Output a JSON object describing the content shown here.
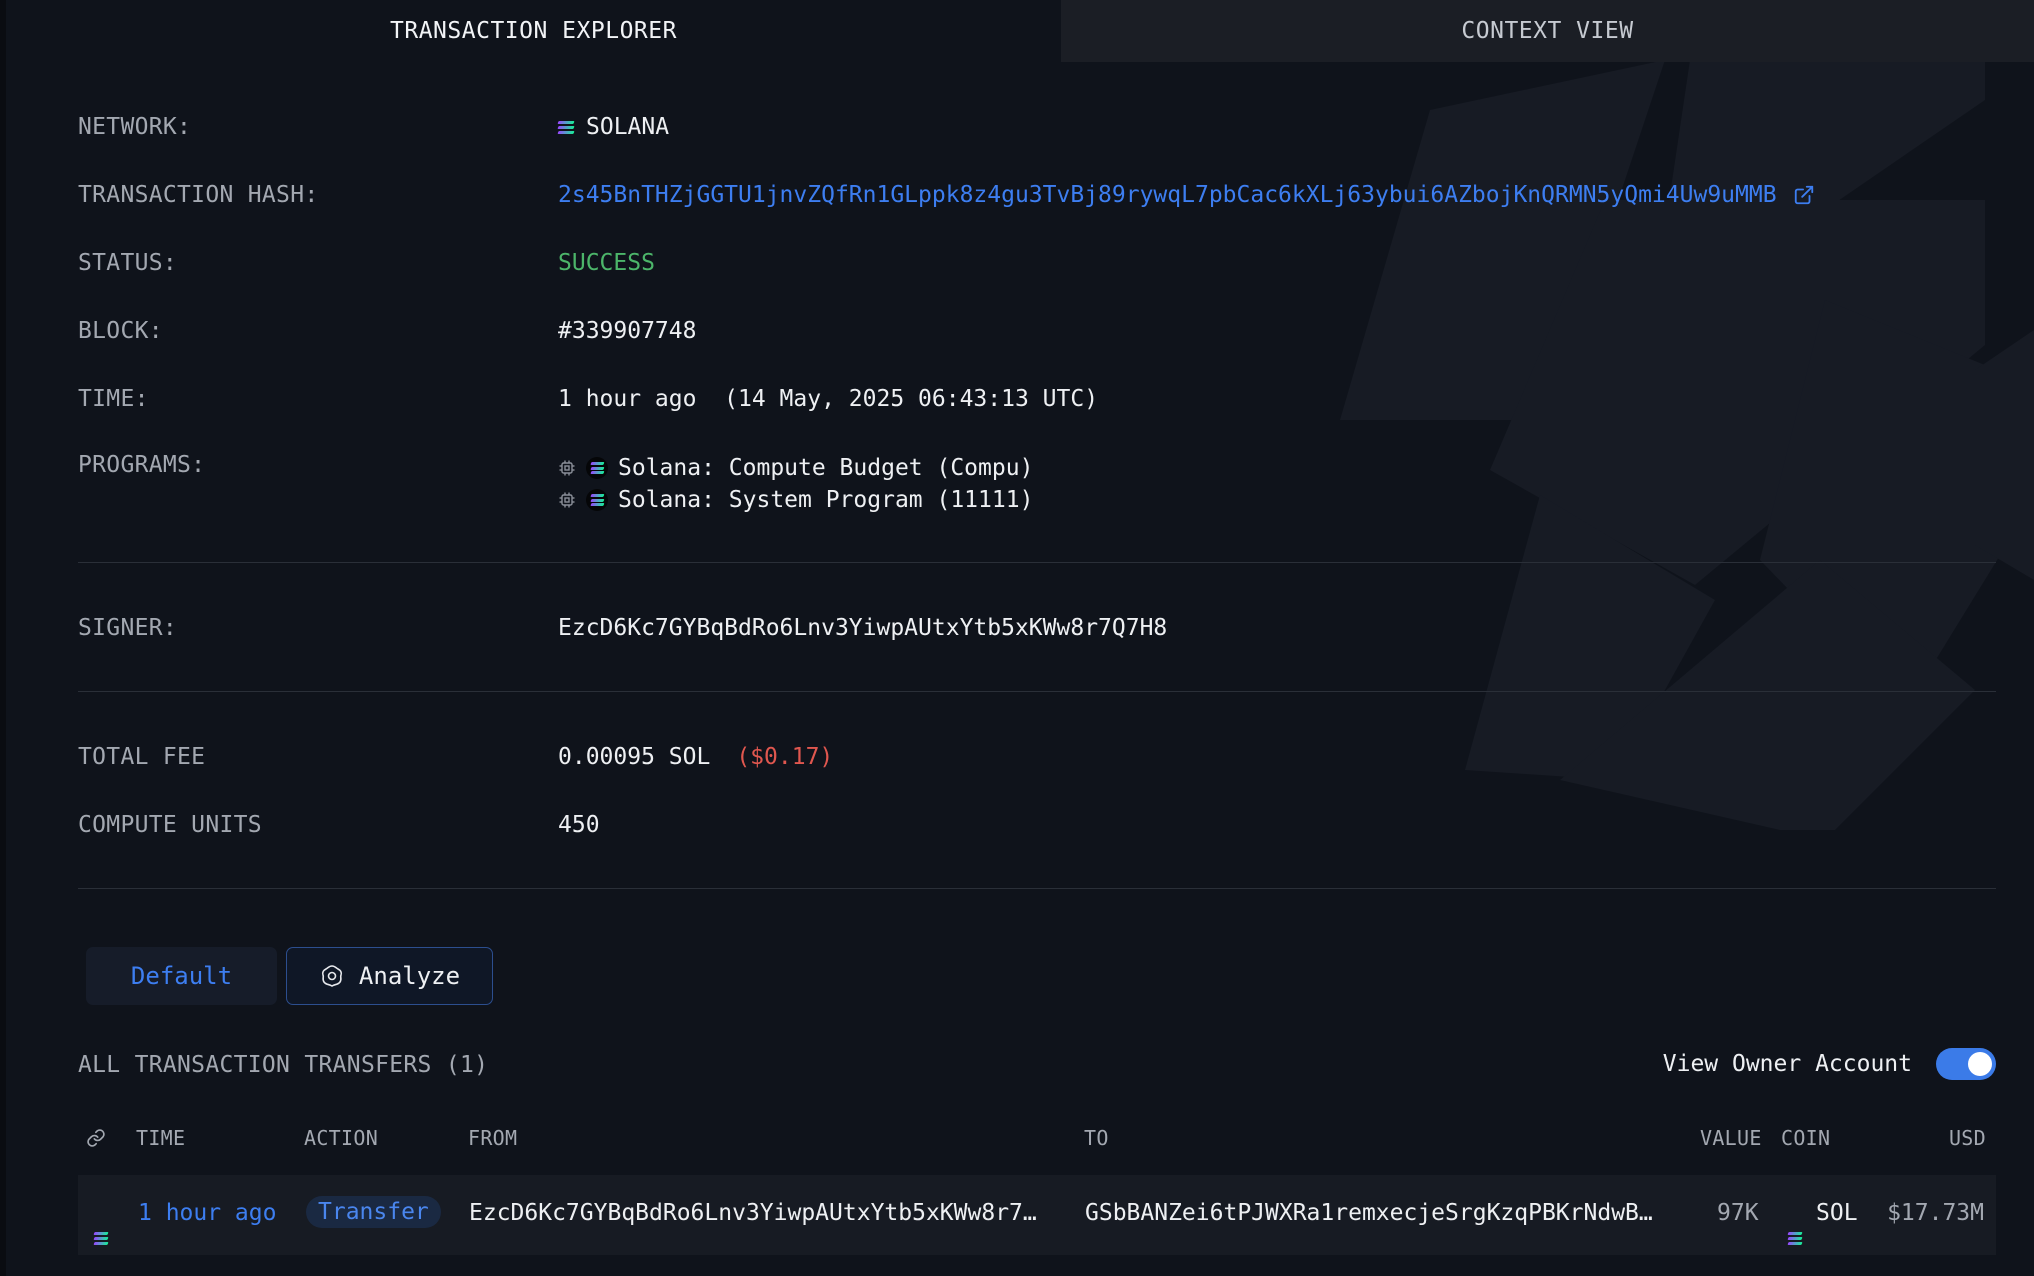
{
  "tabs": {
    "explorer": "TRANSACTION EXPLORER",
    "context": "CONTEXT VIEW"
  },
  "details": {
    "network": {
      "label": "NETWORK:",
      "value": "SOLANA"
    },
    "hash": {
      "label": "TRANSACTION HASH:",
      "value": "2s45BnTHZjGGTU1jnvZQfRn1GLppk8z4gu3TvBj89rywqL7pbCac6kXLj63ybui6AZbojKnQRMN5yQmi4Uw9uMMB"
    },
    "status": {
      "label": "STATUS:",
      "value": "SUCCESS"
    },
    "block": {
      "label": "BLOCK:",
      "value": "#339907748"
    },
    "time": {
      "label": "TIME:",
      "value": "1 hour ago  (14 May, 2025 06:43:13 UTC)"
    },
    "programs": {
      "label": "PROGRAMS:",
      "items": [
        {
          "name": "Solana: Compute Budget (Compu)"
        },
        {
          "name": "Solana: System Program (11111)"
        }
      ]
    },
    "signer": {
      "label": "SIGNER:",
      "value": "EzcD6Kc7GYBqBdRo6Lnv3YiwpAUtxYtb5xKWw8r7Q7H8"
    },
    "fee": {
      "label": "TOTAL FEE",
      "value": "0.00095 SOL",
      "usd": "($0.17)"
    },
    "compute": {
      "label": "COMPUTE UNITS",
      "value": "450"
    }
  },
  "buttons": {
    "default": "Default",
    "analyze": "Analyze"
  },
  "transfers": {
    "title": "ALL TRANSACTION TRANSFERS (1)",
    "toggle_label": "View Owner Account",
    "toggle_on": true,
    "columns": {
      "time": "TIME",
      "action": "ACTION",
      "from": "FROM",
      "to": "TO",
      "value": "VALUE",
      "coin": "COIN",
      "usd": "USD"
    },
    "rows": [
      {
        "time": "1 hour ago",
        "action": "Transfer",
        "from": "EzcD6Kc7GYBqBdRo6Lnv3YiwpAUtxYtb5xKWw8r7…",
        "to": "GSbBANZei6tPJWXRa1remxecjeSrgKzqPBKrNdwB…",
        "value": "97K",
        "coin": "SOL",
        "usd": "$17.73M"
      }
    ]
  },
  "icons": {
    "network": "solana-icon",
    "external": "external-link-icon",
    "program": "chip-icon",
    "analyze": "analyze-icon",
    "link": "link-icon"
  },
  "colors": {
    "link": "#3d7ef1",
    "success": "#4cb56a",
    "fee_usd": "#e0574f",
    "toggle": "#3b7be8"
  }
}
